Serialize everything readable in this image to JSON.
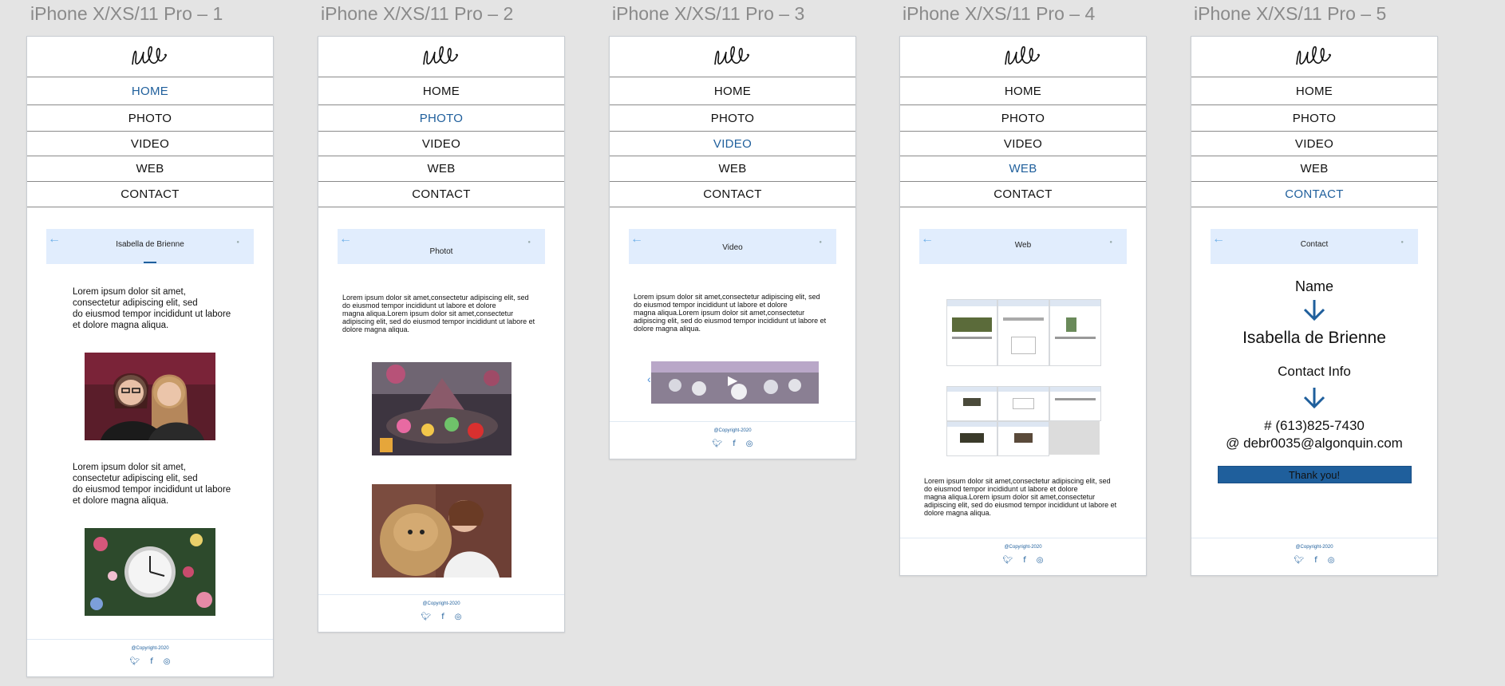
{
  "artboards": [
    {
      "title": "iPhone X/XS/11 Pro – 1",
      "active_nav": "HOME",
      "header": "Isabella de Brienne"
    },
    {
      "title": "iPhone X/XS/11 Pro – 2",
      "active_nav": "PHOTO",
      "header": "Photot"
    },
    {
      "title": "iPhone X/XS/11 Pro – 3",
      "active_nav": "VIDEO",
      "header": "Video"
    },
    {
      "title": "iPhone X/XS/11 Pro – 4",
      "active_nav": "WEB",
      "header": "Web"
    },
    {
      "title": "iPhone X/XS/11 Pro – 5",
      "active_nav": "CONTACT",
      "header": "Contact"
    }
  ],
  "nav": [
    "HOME",
    "PHOTO",
    "VIDEO",
    "WEB",
    "CONTACT"
  ],
  "lorem_short": "Lorem ipsum dolor sit amet,\n consectetur adipiscing elit, sed\ndo eiusmod tempor incididunt ut labore\net dolore magna aliqua.",
  "lorem_long": "Lorem ipsum dolor sit amet,consectetur adipiscing elit, sed\ndo eiusmod tempor incididunt ut labore et dolore\n magna aliqua.Lorem ipsum dolor sit amet,consectetur\nadipiscing elit, sed do eiusmod tempor incididunt ut labore et\n dolore magna aliqua.",
  "footer": {
    "copyright": "@Copyright-2020",
    "icons": [
      "twitter-icon",
      "facebook-icon",
      "instagram-icon"
    ]
  },
  "contact": {
    "name_label": "Name",
    "name": "Isabella de Brienne",
    "info_label": "Contact Info",
    "phone": "# (613)825-7430",
    "email": "@ debr0035@algonquin.com",
    "thanks": "Thank you!"
  },
  "colors": {
    "accent": "#1f5f9c",
    "header_bg": "#e1edfd",
    "canvas": "#e4e4e4"
  }
}
